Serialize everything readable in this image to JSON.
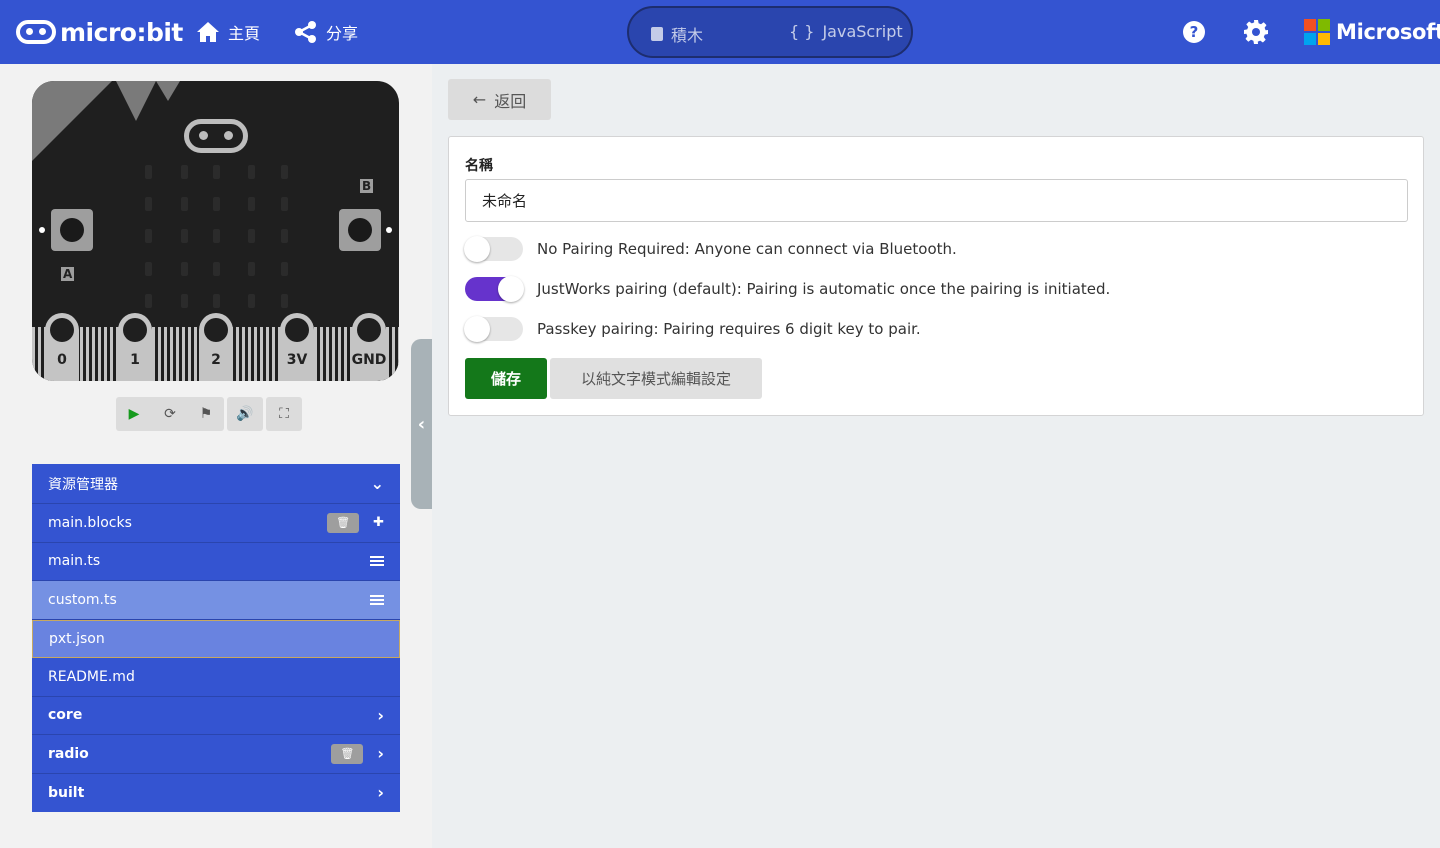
{
  "header": {
    "logo_text": "micro:bit",
    "home_label": "主頁",
    "share_label": "分享",
    "editor_tabs": [
      {
        "label": "積木",
        "icon": "puzzle-icon"
      },
      {
        "label": "JavaScript",
        "icon": "braces-icon"
      }
    ],
    "braces_glyph": "{ }",
    "help_glyph": "?",
    "brand_text": "Microsoft"
  },
  "simulator": {
    "button_a": "A",
    "button_b": "B",
    "pins": [
      "0",
      "1",
      "2",
      "3V",
      "GND"
    ],
    "controls": [
      "play-icon",
      "restart-icon",
      "debug-icon",
      "mute-icon",
      "fullscreen-icon"
    ]
  },
  "explorer": {
    "title": "資源管理器",
    "files": [
      {
        "name": "main.blocks",
        "state": "normal",
        "deletable": true,
        "icon": "puzzle-icon"
      },
      {
        "name": "main.ts",
        "state": "normal",
        "deletable": false,
        "icon": "lines-icon"
      },
      {
        "name": "custom.ts",
        "state": "active",
        "deletable": false,
        "icon": "lines-icon"
      },
      {
        "name": "pxt.json",
        "state": "selected",
        "deletable": false,
        "icon": ""
      },
      {
        "name": "README.md",
        "state": "normal",
        "deletable": false,
        "icon": ""
      },
      {
        "name": "core",
        "state": "folder",
        "deletable": false,
        "icon": "chevron-right-icon"
      },
      {
        "name": "radio",
        "state": "folder",
        "deletable": true,
        "icon": "chevron-right-icon"
      },
      {
        "name": "built",
        "state": "folder",
        "deletable": false,
        "icon": "chevron-right-icon"
      }
    ]
  },
  "settings": {
    "back_label": "返回",
    "name_label": "名稱",
    "name_value": "未命名",
    "options": [
      {
        "label": "No Pairing Required: Anyone can connect via Bluetooth.",
        "checked": false
      },
      {
        "label": "JustWorks pairing (default): Pairing is automatic once the pairing is initiated.",
        "checked": true
      },
      {
        "label": "Passkey pairing: Pairing requires 6 digit key to pair.",
        "checked": false
      }
    ],
    "save_label": "儲存",
    "text_mode_label": "以純文字模式編輯設定"
  },
  "colors": {
    "topbar": "#3454d1",
    "save": "#14781a",
    "toggle_on": "#6633cc",
    "ms_red": "#f25022",
    "ms_green": "#7fba00",
    "ms_blue": "#00a4ef",
    "ms_yellow": "#ffb900"
  }
}
